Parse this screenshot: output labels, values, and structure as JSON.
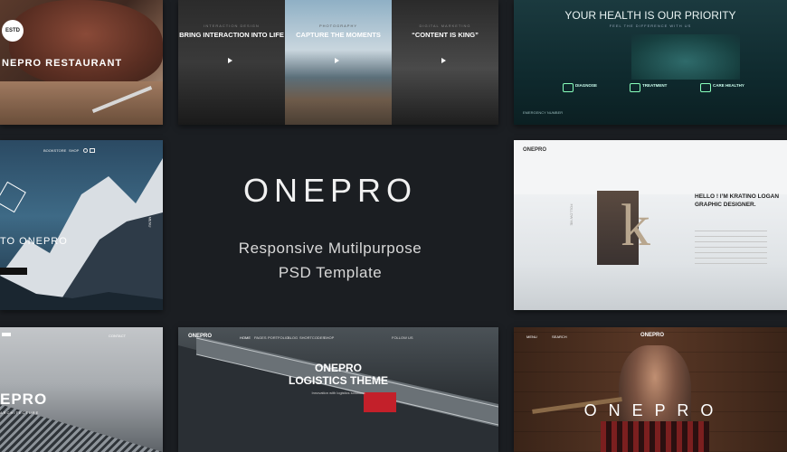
{
  "hero": {
    "title": "ONEPRO",
    "subtitle_line1": "Responsive Mutilpurpose",
    "subtitle_line2": "PSD Template"
  },
  "restaurant": {
    "title": "NEPRO RESTAURANT",
    "badge": "ESTD"
  },
  "interaction_panels": [
    {
      "top": "INTERACTION DESIGN",
      "heading": "BRING INTERACTION INTO LIFE"
    },
    {
      "top": "PHOTOGRAPHY",
      "heading": "CAPTURE THE MOMENTS"
    },
    {
      "top": "DIGITAL MARKETING",
      "heading": "“CONTENT IS KING”"
    }
  ],
  "health": {
    "title": "YOUR HEALTH IS OUR PRIORITY",
    "subtitle": "FEEL THE DIFFERENCE WITH US",
    "columns": [
      "DIAGNOSE",
      "TREATMENT",
      "CARE HEALTHY"
    ],
    "small_label": "EMERGENCY NUMBER"
  },
  "mountain": {
    "title": "TO ONEPRO",
    "nav": [
      "BOOKSTORE",
      "SHOP"
    ],
    "side": "MENU"
  },
  "portfolio": {
    "logo": "ONEPRO",
    "greeting": "HELLO ! I’M KRATINO LOGAN",
    "role": "GRAPHIC DESIGNER.",
    "side": "FOLLOW ME"
  },
  "arch": {
    "title": "EPRO",
    "tagline": "ARCHITECTURE",
    "nav": "CONTACT"
  },
  "logistics": {
    "logo": "ONEPRO",
    "nav": [
      "HOME",
      "PAGES",
      "PORTFOLIO",
      "BLOG",
      "SHORTCODES",
      "SHOP"
    ],
    "follow": "FOLLOW US",
    "title_line1": "ONEPRO",
    "title_line2": "LOGISTICS THEME",
    "tagline": "Innovation with logistics solutions"
  },
  "barber": {
    "logo": "ONEPRO",
    "menu": "MENU",
    "search": "SEARCH",
    "title": "O N E P R O"
  },
  "colors": {
    "background": "#1b1e22",
    "accent": "#e74c3c"
  }
}
